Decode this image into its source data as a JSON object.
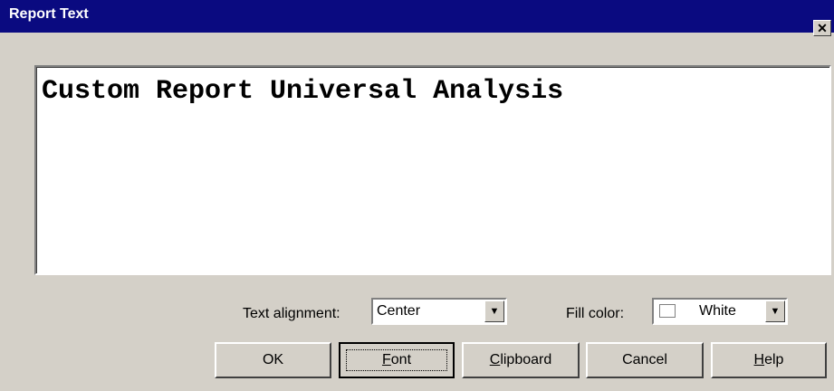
{
  "window": {
    "title": "Report Text",
    "close_glyph": "✕"
  },
  "editor": {
    "text": "Custom Report Universal Analysis"
  },
  "alignment": {
    "label": "Text alignment:",
    "value": "Center"
  },
  "fill": {
    "label": "Fill color:",
    "value": "White",
    "swatch_color": "#ffffff"
  },
  "buttons": {
    "ok": "OK",
    "font_mnemonic": "F",
    "font_rest": "ont",
    "clipboard_mnemonic": "C",
    "clipboard_rest": "lipboard",
    "cancel": "Cancel",
    "help_mnemonic": "H",
    "help_rest": "elp"
  },
  "colors": {
    "titlebar": "#0a0a80",
    "face": "#d4d0c8"
  },
  "icons": {
    "dropdown": "chevron-down-icon",
    "close": "close-icon"
  }
}
